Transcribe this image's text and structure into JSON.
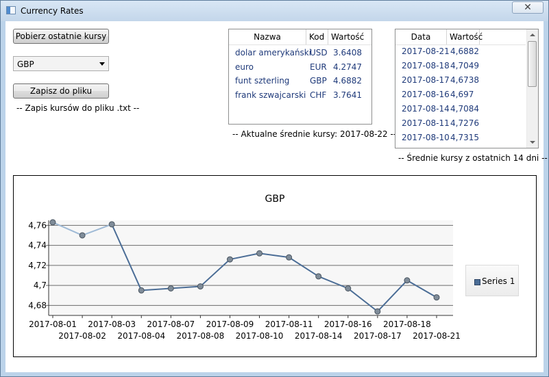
{
  "window": {
    "title": "Currency Rates",
    "close_glyph": "✕"
  },
  "controls": {
    "fetch_button": "Pobierz ostatnie kursy",
    "currency_select": "GBP",
    "save_button": "Zapisz do pliku",
    "save_note": "-- Zapis kursów do pliku .txt --"
  },
  "current_rates": {
    "headers": [
      "Nazwa",
      "Kod",
      "Wartość"
    ],
    "rows": [
      {
        "name": "dolar amerykański",
        "code": "USD",
        "value": "3.6408"
      },
      {
        "name": "euro",
        "code": "EUR",
        "value": "4.2747"
      },
      {
        "name": "funt szterling",
        "code": "GBP",
        "value": "4.6882"
      },
      {
        "name": "frank szwajcarski",
        "code": "CHF",
        "value": "3.7641"
      }
    ],
    "caption": "-- Aktualne średnie kursy: 2017-08-22 --"
  },
  "history": {
    "headers": [
      "Data",
      "Wartość"
    ],
    "rows": [
      {
        "date": "2017-08-21",
        "value": "4,6882"
      },
      {
        "date": "2017-08-18",
        "value": "4,7049"
      },
      {
        "date": "2017-08-17",
        "value": "4,6738"
      },
      {
        "date": "2017-08-16",
        "value": "4,697"
      },
      {
        "date": "2017-08-14",
        "value": "4,7084"
      },
      {
        "date": "2017-08-11",
        "value": "4,7276"
      },
      {
        "date": "2017-08-10",
        "value": "4,7315"
      }
    ],
    "caption": "-- Średnie kursy z ostatnich 14 dni --"
  },
  "chart_data": {
    "type": "line",
    "title": "GBP",
    "categories": [
      "2017-08-01",
      "2017-08-02",
      "2017-08-03",
      "2017-08-04",
      "2017-08-07",
      "2017-08-08",
      "2017-08-09",
      "2017-08-10",
      "2017-08-11",
      "2017-08-14",
      "2017-08-16",
      "2017-08-17",
      "2017-08-18",
      "2017-08-21"
    ],
    "series": [
      {
        "name": "Series 1",
        "values": [
          4.763,
          4.75,
          4.761,
          4.695,
          4.697,
          4.699,
          4.726,
          4.732,
          4.728,
          4.709,
          4.697,
          4.674,
          4.705,
          4.688
        ]
      }
    ],
    "y_ticks": [
      "4,68",
      "4,7",
      "4,72",
      "4,74",
      "4,76"
    ],
    "ylim": [
      4.67,
      4.765
    ],
    "grid": true,
    "legend": "right",
    "line_color": "#4b6d96"
  }
}
